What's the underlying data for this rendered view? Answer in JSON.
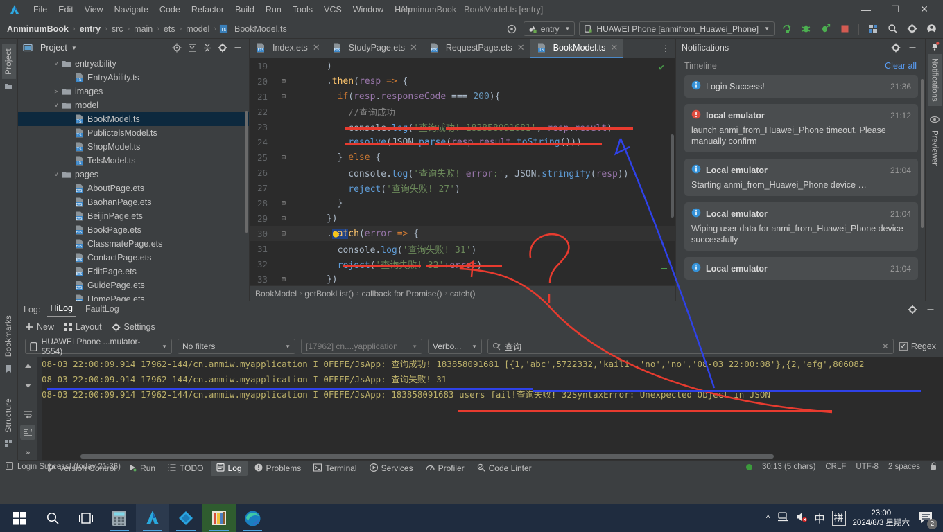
{
  "window": {
    "title": "AnminumBook - BookModel.ts [entry]"
  },
  "menu": {
    "items": [
      "File",
      "Edit",
      "View",
      "Navigate",
      "Code",
      "Refactor",
      "Build",
      "Run",
      "Tools",
      "VCS",
      "Window",
      "Help"
    ],
    "minimize": "—",
    "maximize": "☐",
    "close": "✕"
  },
  "navbar": {
    "breadcrumbs": [
      {
        "label": "AnminumBook",
        "bold": true
      },
      {
        "label": "entry",
        "bold": true
      },
      {
        "label": "src",
        "bold": false
      },
      {
        "label": "main",
        "bold": false
      },
      {
        "label": "ets",
        "bold": false
      },
      {
        "label": "model",
        "bold": false
      },
      {
        "label": "BookModel.ts",
        "bold": false
      }
    ],
    "separator": "›",
    "run_config": "entry",
    "device": "HUAWEI Phone [anmifrom_Huawei_Phone]",
    "icons": [
      "target-icon",
      "run-icon",
      "debug-icon",
      "attach-debugger-icon",
      "stop-icon",
      "device-manager-icon",
      "search-icon",
      "gear-icon",
      "account-icon"
    ]
  },
  "left_strip": {
    "tabs": [
      "Project",
      "Bookmarks",
      "Structure"
    ]
  },
  "project": {
    "title": "Project",
    "header_icons": [
      "locate-icon",
      "collapse-icon",
      "expand-icon",
      "gear-icon",
      "minimize-icon"
    ],
    "tree": [
      {
        "label": "entryability",
        "type": "folder",
        "depth": 2,
        "arrow": "down"
      },
      {
        "label": "EntryAbility.ts",
        "type": "ts",
        "depth": 3,
        "arrow": "none"
      },
      {
        "label": "images",
        "type": "folder",
        "depth": 2,
        "arrow": "right"
      },
      {
        "label": "model",
        "type": "folder",
        "depth": 2,
        "arrow": "down"
      },
      {
        "label": "BookModel.ts",
        "type": "ts",
        "depth": 3,
        "arrow": "none",
        "selected": true
      },
      {
        "label": "PublictelsModel.ts",
        "type": "ts",
        "depth": 3,
        "arrow": "none"
      },
      {
        "label": "ShopModel.ts",
        "type": "ts",
        "depth": 3,
        "arrow": "none"
      },
      {
        "label": "TelsModel.ts",
        "type": "ts",
        "depth": 3,
        "arrow": "none"
      },
      {
        "label": "pages",
        "type": "folder",
        "depth": 2,
        "arrow": "down"
      },
      {
        "label": "AboutPage.ets",
        "type": "ets",
        "depth": 3,
        "arrow": "none"
      },
      {
        "label": "BaohanPage.ets",
        "type": "ets",
        "depth": 3,
        "arrow": "none"
      },
      {
        "label": "BeijinPage.ets",
        "type": "ets",
        "depth": 3,
        "arrow": "none"
      },
      {
        "label": "BookPage.ets",
        "type": "ets",
        "depth": 3,
        "arrow": "none"
      },
      {
        "label": "ClassmatePage.ets",
        "type": "ets",
        "depth": 3,
        "arrow": "none"
      },
      {
        "label": "ContactPage.ets",
        "type": "ets",
        "depth": 3,
        "arrow": "none"
      },
      {
        "label": "EditPage.ets",
        "type": "ets",
        "depth": 3,
        "arrow": "none"
      },
      {
        "label": "GuidePage.ets",
        "type": "ets",
        "depth": 3,
        "arrow": "none"
      },
      {
        "label": "HomePage.ets",
        "type": "ets",
        "depth": 3,
        "arrow": "none"
      }
    ]
  },
  "editor": {
    "tabs": [
      {
        "label": "Index.ets",
        "type": "ets",
        "active": false
      },
      {
        "label": "StudyPage.ets",
        "type": "ets",
        "active": false
      },
      {
        "label": "RequestPage.ets",
        "type": "ets",
        "active": false
      },
      {
        "label": "BookModel.ts",
        "type": "ts",
        "active": true
      }
    ],
    "lines": [
      {
        "n": "19",
        "text": "      )"
      },
      {
        "n": "20",
        "text": "      .then(resp => {"
      },
      {
        "n": "21",
        "text": "        if(resp.responseCode === 200){"
      },
      {
        "n": "22",
        "text": "          //查询成功"
      },
      {
        "n": "23",
        "text": "          console.log('查询成功! 183858091681', resp.result)"
      },
      {
        "n": "24",
        "text": "          resolve(JSON.parse(resp.result.toString()))"
      },
      {
        "n": "25",
        "text": "        } else {"
      },
      {
        "n": "26",
        "text": "          console.log('查询失败! error:', JSON.stringify(resp))"
      },
      {
        "n": "27",
        "text": "          reject('查询失败! 27')"
      },
      {
        "n": "28",
        "text": "        }"
      },
      {
        "n": "29",
        "text": "      })"
      },
      {
        "n": "30",
        "text": "      .catch(error => {"
      },
      {
        "n": "31",
        "text": "        console.log('查询失败! 31')"
      },
      {
        "n": "32",
        "text": "        reject('查询失败! 32'+error)"
      },
      {
        "n": "33",
        "text": "      })"
      },
      {
        "n": "34",
        "text": "    })"
      }
    ],
    "breadcrumbs": [
      "BookModel",
      "getBookList()",
      "callback for Promise()",
      "catch()"
    ],
    "breadcrumb_sep": "›"
  },
  "notifications": {
    "title": "Notifications",
    "timeline_label": "Timeline",
    "clear_all": "Clear all",
    "items": [
      {
        "title": "Login Success!",
        "time": "21:36",
        "body": "",
        "level": "info",
        "bold": false
      },
      {
        "title": "local emulator",
        "time": "21:12",
        "body": "launch anmi_from_Huawei_Phone timeout, Please manually confirm",
        "level": "error",
        "bold": true
      },
      {
        "title": "Local emulator",
        "time": "21:04",
        "body": "Starting anmi_from_Huawei_Phone device …",
        "level": "info",
        "bold": true
      },
      {
        "title": "Local emulator",
        "time": "21:04",
        "body": "Wiping user data for anmi_from_Huawei_Phone device successfully",
        "level": "info",
        "bold": true
      },
      {
        "title": "Local emulator",
        "time": "21:04",
        "body": "",
        "level": "info",
        "bold": true
      }
    ]
  },
  "right_strip": {
    "tabs": [
      "Notifications",
      "Previewer"
    ]
  },
  "log": {
    "label": "Log:",
    "tabs": [
      {
        "label": "HiLog",
        "active": true
      },
      {
        "label": "FaultLog",
        "active": false
      }
    ],
    "actions": [
      {
        "label": "New",
        "icon": "plus-icon"
      },
      {
        "label": "Layout",
        "icon": "layout-icon"
      },
      {
        "label": "Settings",
        "icon": "gear-icon"
      }
    ],
    "filters": {
      "device": "HUAWEI Phone ...mulator-5554)",
      "filter": "No filters",
      "process": "[17962] cn....yapplication",
      "level": "Verbo...",
      "search_value": "查询",
      "regex_label": "Regex",
      "regex_checked": true
    },
    "lines": [
      "08-03 22:00:09.914 17962-144/cn.anmiw.myapplication I 0FEFE/JsApp: 查询成功! 183858091681 [{1,'abc',5722332,'kaili','no','no','08-03 22:00:08'},{2,'efg',806082",
      "08-03 22:00:09.914 17962-144/cn.anmiw.myapplication I 0FEFE/JsApp: 查询失败! 31",
      "08-03 22:00:09.914 17962-144/cn.anmiw.myapplication I 0FEFE/JsApp: 183858091683 users fail!查询失败! 32SyntaxError: Unexpected Object in JSON"
    ],
    "side_icons": [
      "soft-wrap-icon",
      "scroll-to-end-icon",
      "expand-icon"
    ]
  },
  "toolwindows": [
    {
      "label": "Version Control",
      "icon": "branch-icon",
      "active": false
    },
    {
      "label": "Run",
      "icon": "run-icon",
      "active": false
    },
    {
      "label": "TODO",
      "icon": "todo-icon",
      "active": false
    },
    {
      "label": "Log",
      "icon": "log-icon",
      "active": true
    },
    {
      "label": "Problems",
      "icon": "problems-icon",
      "active": false
    },
    {
      "label": "Terminal",
      "icon": "terminal-icon",
      "active": false
    },
    {
      "label": "Services",
      "icon": "services-icon",
      "active": false
    },
    {
      "label": "Profiler",
      "icon": "profiler-icon",
      "active": false
    },
    {
      "label": "Code Linter",
      "icon": "linter-icon",
      "active": false
    }
  ],
  "statusbar": {
    "message": "Login Success! (today 21:36)",
    "caret": "30:13 (5 chars)",
    "line_sep": "CRLF",
    "encoding": "UTF-8",
    "indent": "2 spaces",
    "lock_icon": "unlock-icon"
  },
  "taskbar": {
    "items": [
      "start-icon",
      "search-icon",
      "task-view-icon",
      "calculator-icon",
      "deveco-studio-icon",
      "app-blue-icon",
      "paint-icon",
      "edge-icon"
    ],
    "tray": [
      "chevron-up-icon",
      "network-icon",
      "volume-muted-icon"
    ],
    "ime_lang": "中",
    "ime_mode": "拼",
    "time": "23:00",
    "date": "2024/8/3 星期六",
    "notification_count": "2"
  },
  "colors": {
    "accent": "#4a88c7",
    "bg": "#3c3f41",
    "editor_bg": "#2b2b2b",
    "annotation_red": "#e83b2f",
    "annotation_blue": "#2f42e8"
  }
}
